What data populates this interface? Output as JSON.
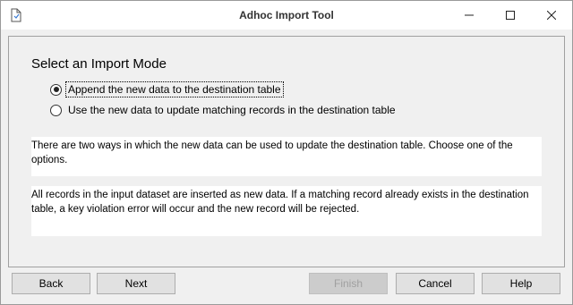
{
  "window": {
    "title": "Adhoc Import Tool",
    "controls": [
      "minimize-icon",
      "maximize-icon",
      "close-icon"
    ]
  },
  "content": {
    "section_title": "Select an Import Mode",
    "options": [
      {
        "label": "Append the new data to the destination table",
        "selected": true
      },
      {
        "label": "Use the new data to update matching records in the destination table",
        "selected": false
      }
    ],
    "description": "There are two ways in which the new data can be used to update the destination table. Choose one of the options.",
    "detail": "All records in the input dataset are inserted as new data. If a matching record already exists in the destination table, a key violation error will occur and the new record will be rejected."
  },
  "buttons": {
    "back": "Back",
    "next": "Next",
    "finish": "Finish",
    "cancel": "Cancel",
    "help": "Help"
  },
  "colors": {
    "window_bg": "#f0f0f0",
    "button_bg": "#e1e1e1",
    "disabled_text": "#a0a0a0"
  }
}
